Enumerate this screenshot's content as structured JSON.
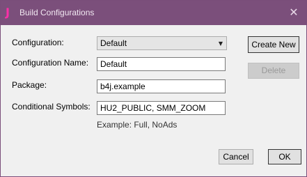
{
  "window": {
    "title": "Build Configurations",
    "icon": "J",
    "close_glyph": "✕"
  },
  "form": {
    "configuration_label": "Configuration:",
    "configuration_value": "Default",
    "configuration_name_label": "Configuration Name:",
    "configuration_name_value": "Default",
    "package_label": "Package:",
    "package_value": "b4j.example",
    "conditional_symbols_label": "Conditional Symbols:",
    "conditional_symbols_value": "HU2_PUBLIC, SMM_ZOOM",
    "hint": "Example: Full, NoAds"
  },
  "buttons": {
    "create_new": "Create New",
    "delete": "Delete",
    "cancel": "Cancel",
    "ok": "OK"
  },
  "colors": {
    "titlebar": "#7b4f7b",
    "app_icon": "#ff2fa8"
  }
}
